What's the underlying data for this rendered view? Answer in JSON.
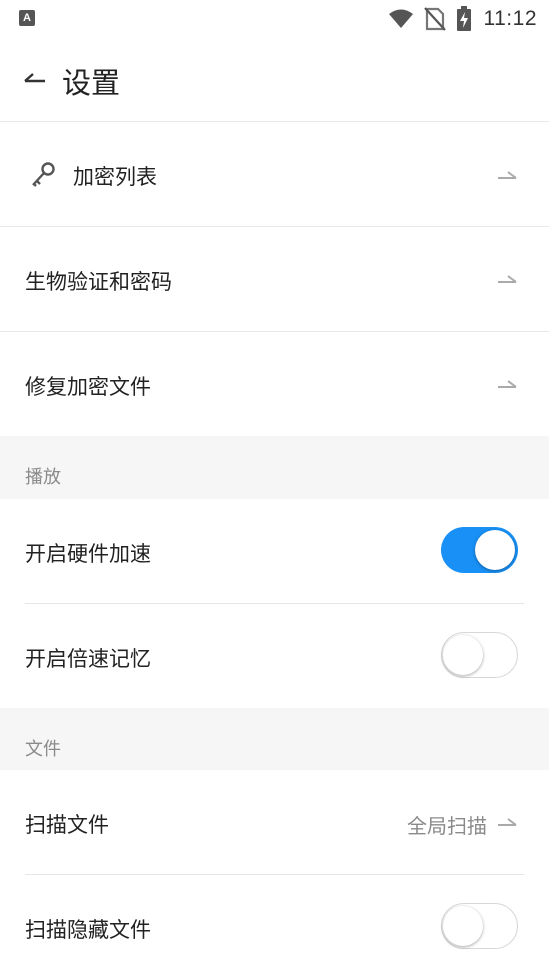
{
  "status_bar": {
    "app_icon_letter": "A",
    "time": "11:12",
    "icons": [
      "wifi-icon",
      "no-sim-icon",
      "battery-charging-icon"
    ]
  },
  "app_bar": {
    "back_icon": "back-arrow-icon",
    "title": "设置"
  },
  "settings": {
    "encrypted_list": {
      "label": "加密列表",
      "icon": "key-icon"
    },
    "biometric": {
      "label": "生物验证和密码"
    },
    "repair": {
      "label": "修复加密文件"
    }
  },
  "playback": {
    "section_title": "播放",
    "hw_accel": {
      "label": "开启硬件加速",
      "enabled": true
    },
    "speed_memory": {
      "label": "开启倍速记忆",
      "enabled": false
    }
  },
  "files": {
    "section_title": "文件",
    "scan_files": {
      "label": "扫描文件",
      "value": "全局扫描"
    },
    "scan_hidden": {
      "label": "扫描隐藏文件",
      "enabled": false
    }
  },
  "colors": {
    "accent": "#1890f5",
    "section_bg": "#f6f6f6",
    "secondary_text": "#8a8a8a"
  }
}
